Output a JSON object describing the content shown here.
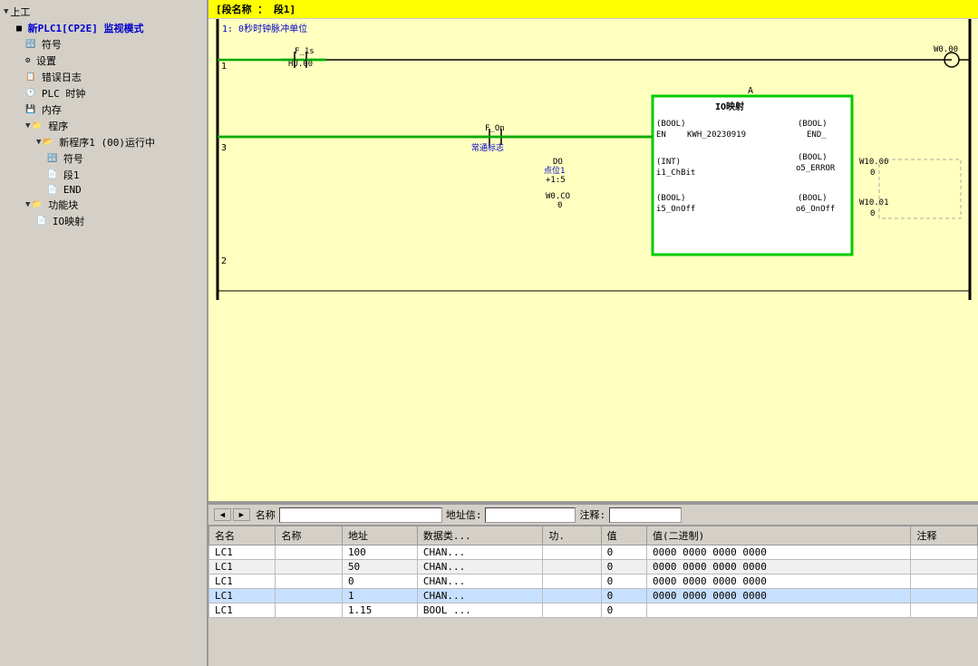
{
  "app": {
    "top_label": "新PLC1[CP2E] 监视模式"
  },
  "sidebar": {
    "items": [
      {
        "id": "root",
        "label": "上工",
        "level": 0,
        "expand": "▼",
        "icon": "🖥"
      },
      {
        "id": "plc1",
        "label": "新PLC1[CP2E] 监视模式",
        "level": 0,
        "expand": "",
        "icon": ""
      },
      {
        "id": "symbol",
        "label": "符号",
        "level": 1,
        "expand": "",
        "icon": "🔣"
      },
      {
        "id": "settings",
        "label": "设置",
        "level": 1,
        "expand": "",
        "icon": "⚙"
      },
      {
        "id": "errlog",
        "label": "错误日志",
        "level": 1,
        "expand": "",
        "icon": "📋"
      },
      {
        "id": "plctimer",
        "label": "PLC 时钟",
        "level": 1,
        "expand": "",
        "icon": "🕐"
      },
      {
        "id": "memory",
        "label": "内存",
        "level": 1,
        "expand": "",
        "icon": "💾"
      },
      {
        "id": "program",
        "label": "程序",
        "level": 1,
        "expand": "▼",
        "icon": "📁"
      },
      {
        "id": "prog1",
        "label": "新程序1 (00)运行中",
        "level": 2,
        "expand": "▼",
        "icon": "📂"
      },
      {
        "id": "symbol2",
        "label": "符号",
        "level": 3,
        "expand": "",
        "icon": "🔣"
      },
      {
        "id": "section1",
        "label": "段1",
        "level": 3,
        "expand": "",
        "icon": "📄"
      },
      {
        "id": "end",
        "label": "END",
        "level": 3,
        "expand": "",
        "icon": "📄"
      },
      {
        "id": "funcblock",
        "label": "功能块",
        "level": 1,
        "expand": "▼",
        "icon": "📁"
      },
      {
        "id": "iomapping",
        "label": "IO映射",
        "level": 2,
        "expand": "",
        "icon": "📄"
      }
    ]
  },
  "ladder": {
    "title": "[段名称 ： 段1]",
    "rung1_comment": "1: 0秒时钟脉冲单位",
    "rung1_num": "1",
    "rung1_sub": "3",
    "rung2_num": "2",
    "contact1_label": "F_1s",
    "contact1_addr": "HU.00",
    "coil1_addr": "W0.00",
    "contact2_label": "F_On",
    "contact2_note": "常通标志",
    "func_block_name": "IO映射",
    "func_block_label": "A",
    "func_param_en": "EN",
    "func_param_en_type": "(BOOL)",
    "func_param_kwh": "KWH_20230919",
    "func_param_end_out": "END_",
    "func_param_end_type": "(BOOL)",
    "func_param_do": "DO",
    "func_param_do_addr": "点位1",
    "func_param_do_val": "+1:5",
    "func_param_int": "(INT)",
    "func_param_i1": "i1_ChBit",
    "func_param_error": "o5_ERROR",
    "func_param_error_type": "(BOOL)",
    "func_param_w1000": "W10.00",
    "func_param_w1000_val": "0",
    "func_param_wo_co": "W0.CO",
    "func_param_wo_co_val": "0",
    "func_param_bool_in": "(BOOL)",
    "func_param_i5": "i5_OnOff",
    "func_param_o6": "o6_OnOff",
    "func_param_o6_type": "(BOOL)",
    "func_param_w1001": "W10.01",
    "func_param_w1001_val": "0"
  },
  "bottom_toolbar": {
    "nav_left": "◄",
    "nav_right": "►",
    "name_label": "名称",
    "name_placeholder": "",
    "addr_label": "地址信:",
    "addr_placeholder": "",
    "comment_label": "注释:",
    "comment_placeholder": ""
  },
  "table": {
    "headers": [
      "名名",
      "名称",
      "地址",
      "数据类...",
      "功.",
      "值",
      "值(二进制)",
      "注释"
    ],
    "rows": [
      {
        "plc": "LC1",
        "name": "",
        "addr": "100",
        "dtype": "CHAN...",
        "func": "",
        "val": "0",
        "binary": "0000 0000 0000 0000",
        "comment": "",
        "selected": false
      },
      {
        "plc": "LC1",
        "name": "",
        "addr": "50",
        "dtype": "CHAN...",
        "func": "",
        "val": "0",
        "binary": "0000 0000 0000 0000",
        "comment": "",
        "selected": false
      },
      {
        "plc": "LC1",
        "name": "",
        "addr": "0",
        "dtype": "CHAN...",
        "func": "",
        "val": "0",
        "binary": "0000 0000 0000 0000",
        "comment": "",
        "selected": false
      },
      {
        "plc": "LC1",
        "name": "",
        "addr": "1",
        "dtype": "CHAN...",
        "func": "",
        "val": "0",
        "binary": "0000 0000 0000 0000",
        "comment": "",
        "selected": true
      },
      {
        "plc": "LC1",
        "name": "",
        "addr": "1.15",
        "dtype": "BOOL ...",
        "func": "",
        "val": "0",
        "binary": "",
        "comment": "",
        "selected": false
      }
    ]
  },
  "colors": {
    "ladder_bg": "#ffffc0",
    "title_bg": "#ffff00",
    "func_block_border": "#00cc00",
    "signal_on": "#00aa00",
    "sidebar_bg": "#d4d0c8",
    "selected_row": "#c8dcf0"
  }
}
